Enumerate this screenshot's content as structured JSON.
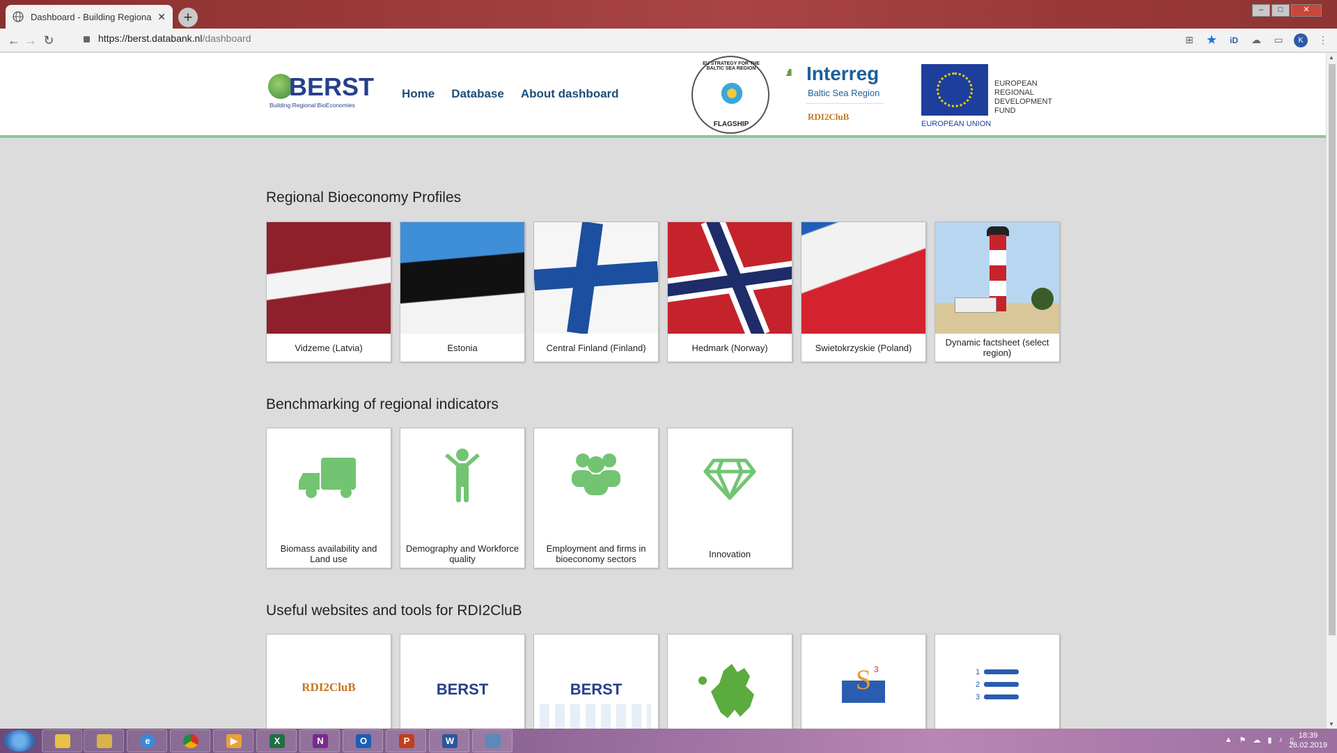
{
  "browser": {
    "tab_title": "Dashboard - Building Regional B",
    "tab_close": "✕",
    "new_tab": "+",
    "url_host": "https://berst.databank.nl",
    "url_path": "/dashboard",
    "profile_initial": "K",
    "window_controls": {
      "minimize": "–",
      "maximize": "□",
      "close": "✕"
    }
  },
  "site": {
    "logo": {
      "word": "BERST",
      "tagline": "Building Regional BioEconomies"
    },
    "nav": [
      {
        "label": "Home"
      },
      {
        "label": "Database"
      },
      {
        "label": "About dashboard"
      }
    ],
    "partners": {
      "flagship_ring": "EU STRATEGY FOR THE BALTIC SEA REGION",
      "flagship_label": "FLAGSHIP",
      "interreg_name": "Interreg",
      "interreg_sub": "Baltic Sea Region",
      "interreg_project": "RDI2CluB",
      "eu_label": "EUROPEAN UNION",
      "eu_fund": "EUROPEAN REGIONAL DEVELOPMENT FUND"
    }
  },
  "sections": {
    "profiles": {
      "title": "Regional Bioeconomy Profiles",
      "cards": [
        {
          "label": "Vidzeme (Latvia)"
        },
        {
          "label": "Estonia"
        },
        {
          "label": "Central Finland (Finland)"
        },
        {
          "label": "Hedmark (Norway)"
        },
        {
          "label": "Swietokrzyskie (Poland)"
        },
        {
          "label": "Dynamic factsheet (select region)"
        }
      ]
    },
    "benchmarking": {
      "title": "Benchmarking of regional indicators",
      "cards": [
        {
          "label": "Biomass availability and Land use",
          "icon": "truck-icon"
        },
        {
          "label": "Demography and Workforce quality",
          "icon": "person-icon"
        },
        {
          "label": "Employment and firms in bioeconomy sectors",
          "icon": "group-icon"
        },
        {
          "label": "Innovation",
          "icon": "diamond-icon"
        }
      ]
    },
    "tools": {
      "title": "Useful websites and tools for RDI2CluB",
      "cards": [
        {
          "logo_text": "RDI2CluB"
        },
        {
          "logo_text": "BERST"
        },
        {
          "logo_text": "BERST"
        },
        {
          "icon": "europe-map-icon"
        },
        {
          "icon": "s3-platform-icon"
        },
        {
          "icon": "numbered-list-icon"
        }
      ]
    }
  },
  "taskbar": {
    "apps": [
      "X",
      "N",
      "O",
      "P",
      "W"
    ],
    "time": "18:39",
    "date": "26.02.2019"
  },
  "colors": {
    "accent_green": "#72c472",
    "nav_blue": "#1e4d7a",
    "header_border": "#8cc98c"
  }
}
